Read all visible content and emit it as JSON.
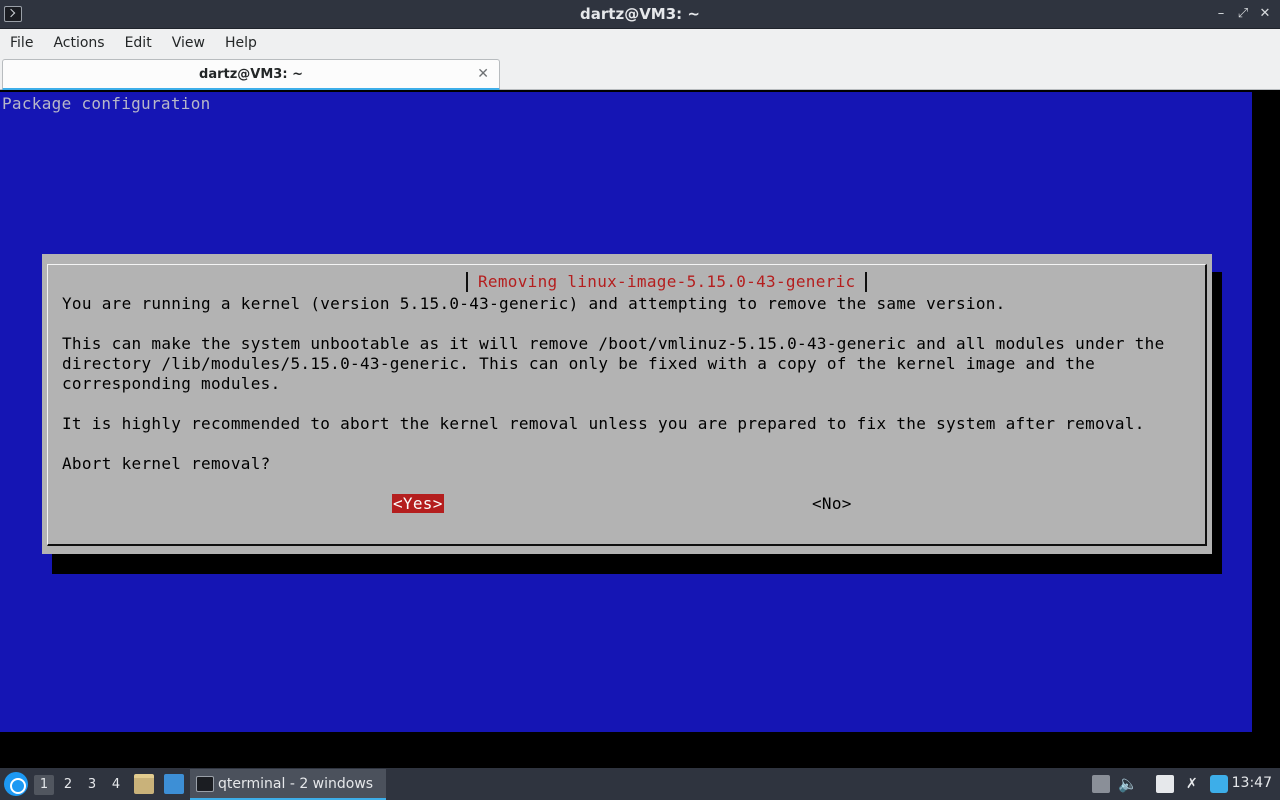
{
  "window": {
    "title": "dartz@VM3: ~",
    "controls": [
      "–",
      "⤢",
      "✕"
    ]
  },
  "menubar": {
    "items": [
      "File",
      "Actions",
      "Edit",
      "View",
      "Help"
    ]
  },
  "tabs": [
    {
      "label": "dartz@VM3: ~",
      "close": "✕"
    }
  ],
  "terminal": {
    "header": "Package configuration",
    "dialog": {
      "title": "Removing linux-image-5.15.0-43-generic",
      "lines": [
        "You are running a kernel (version 5.15.0-43-generic) and attempting to remove the same version.",
        "",
        "This can make the system unbootable as it will remove /boot/vmlinuz-5.15.0-43-generic and all modules under the",
        "directory /lib/modules/5.15.0-43-generic. This can only be fixed with a copy of the kernel image and the",
        "corresponding modules.",
        "",
        "It is highly recommended to abort the kernel removal unless you are prepared to fix the system after removal.",
        "",
        "Abort kernel removal?"
      ],
      "yes_label": "<Yes>",
      "no_label": "<No>"
    }
  },
  "taskbar": {
    "desktops": [
      "1",
      "2",
      "3",
      "4"
    ],
    "active_desktop": "1",
    "task_label": "qterminal - 2 windows",
    "clock": "13:47",
    "icons": [
      "start-menu-icon",
      "file-manager-icon",
      "show-desktop-icon",
      "terminal-icon",
      "disk-icon",
      "volume-icon",
      "clipboard-icon",
      "network-icon",
      "updates-icon"
    ]
  },
  "colors": {
    "terminal_bg": "#1515b4",
    "dialog_bg": "#b3b3b3",
    "accent_red": "#b41e1e",
    "selection": "#3daee9"
  }
}
